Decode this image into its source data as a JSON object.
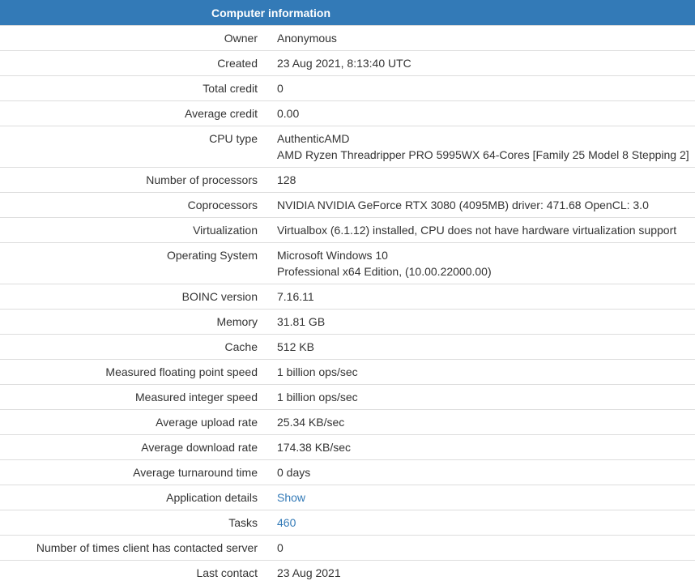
{
  "table": {
    "title": "Computer information",
    "colors": {
      "header_bg": "#337ab7",
      "header_text": "#ffffff",
      "link": "#337ab7",
      "row_border": "#dddddd"
    },
    "rows": [
      {
        "label": "Owner",
        "value": "Anonymous"
      },
      {
        "label": "Created",
        "value": "23 Aug 2021, 8:13:40 UTC"
      },
      {
        "label": "Total credit",
        "value": "0"
      },
      {
        "label": "Average credit",
        "value": "0.00"
      },
      {
        "label": "CPU type",
        "value_line1": "AuthenticAMD",
        "value_line2": "AMD Ryzen Threadripper PRO 5995WX 64-Cores [Family 25 Model 8 Stepping 2]"
      },
      {
        "label": "Number of processors",
        "value": "128"
      },
      {
        "label": "Coprocessors",
        "value": "NVIDIA NVIDIA GeForce RTX 3080 (4095MB) driver: 471.68 OpenCL: 3.0"
      },
      {
        "label": "Virtualization",
        "value": "Virtualbox (6.1.12) installed, CPU does not have hardware virtualization support"
      },
      {
        "label": "Operating System",
        "value_line1": "Microsoft Windows 10",
        "value_line2": "Professional x64 Edition, (10.00.22000.00)"
      },
      {
        "label": "BOINC version",
        "value": "7.16.11"
      },
      {
        "label": "Memory",
        "value": "31.81 GB"
      },
      {
        "label": "Cache",
        "value": "512 KB"
      },
      {
        "label": "Measured floating point speed",
        "value": "1 billion ops/sec"
      },
      {
        "label": "Measured integer speed",
        "value": "1 billion ops/sec"
      },
      {
        "label": "Average upload rate",
        "value": "25.34 KB/sec"
      },
      {
        "label": "Average download rate",
        "value": "174.38 KB/sec"
      },
      {
        "label": "Average turnaround time",
        "value": "0 days"
      },
      {
        "label": "Application details",
        "value": "Show"
      },
      {
        "label": "Tasks",
        "value": "460"
      },
      {
        "label": "Number of times client has contacted server",
        "value": "0"
      },
      {
        "label": "Last contact",
        "value": "23 Aug 2021"
      }
    ]
  }
}
